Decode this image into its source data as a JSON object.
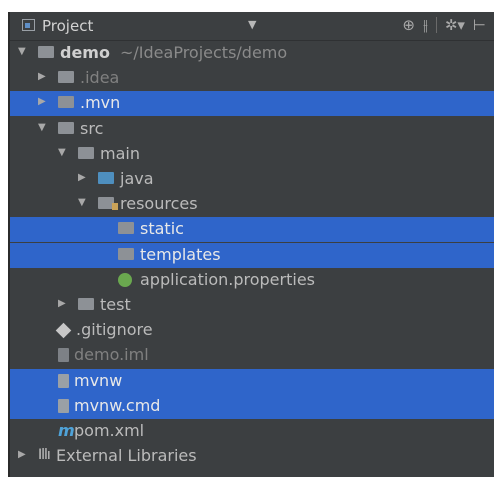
{
  "header": {
    "title": "Project",
    "dropdown_icon": "chevron-down-icon",
    "tools": [
      "target-icon",
      "split-icon",
      "gear-icon",
      "hide-icon"
    ]
  },
  "tree": [
    {
      "label": "demo",
      "path": "~/IdeaProjects/demo",
      "depth": 0,
      "expanded": true,
      "icon": "module-folder-icon",
      "selected": false
    },
    {
      "label": ".idea",
      "depth": 1,
      "expanded": false,
      "icon": "folder-icon",
      "selected": false
    },
    {
      "label": ".mvn",
      "depth": 1,
      "expanded": false,
      "icon": "folder-icon",
      "selected": true
    },
    {
      "label": "src",
      "depth": 1,
      "expanded": true,
      "icon": "folder-icon",
      "selected": false
    },
    {
      "label": "main",
      "depth": 2,
      "expanded": true,
      "icon": "folder-icon",
      "selected": false
    },
    {
      "label": "java",
      "depth": 3,
      "expanded": false,
      "icon": "source-folder-icon",
      "selected": false
    },
    {
      "label": "resources",
      "depth": 3,
      "expanded": true,
      "icon": "resources-folder-icon",
      "selected": false
    },
    {
      "label": "static",
      "depth": 4,
      "icon": "folder-icon",
      "selected": true
    },
    {
      "label": "templates",
      "depth": 4,
      "icon": "folder-icon",
      "selected": true
    },
    {
      "label": "application.properties",
      "depth": 4,
      "icon": "spring-properties-icon",
      "selected": false
    },
    {
      "label": "test",
      "depth": 2,
      "expanded": false,
      "icon": "folder-icon",
      "selected": false
    },
    {
      "label": ".gitignore",
      "depth": 1,
      "icon": "git-icon",
      "selected": false
    },
    {
      "label": "demo.iml",
      "depth": 1,
      "icon": "iml-file-icon",
      "selected": false
    },
    {
      "label": "mvnw",
      "depth": 1,
      "icon": "file-icon",
      "selected": true
    },
    {
      "label": "mvnw.cmd",
      "depth": 1,
      "icon": "file-icon",
      "selected": true
    },
    {
      "label": "pom.xml",
      "depth": 1,
      "icon": "maven-icon",
      "selected": false
    },
    {
      "label": "External Libraries",
      "depth": 0,
      "expanded": false,
      "icon": "libraries-icon",
      "selected": false
    }
  ],
  "colors": {
    "panel_bg": "#3c3f41",
    "selection": "#2f65ca",
    "text": "#bbbbbb",
    "dim_text": "#808080",
    "path_text": "#8a8a8a"
  }
}
